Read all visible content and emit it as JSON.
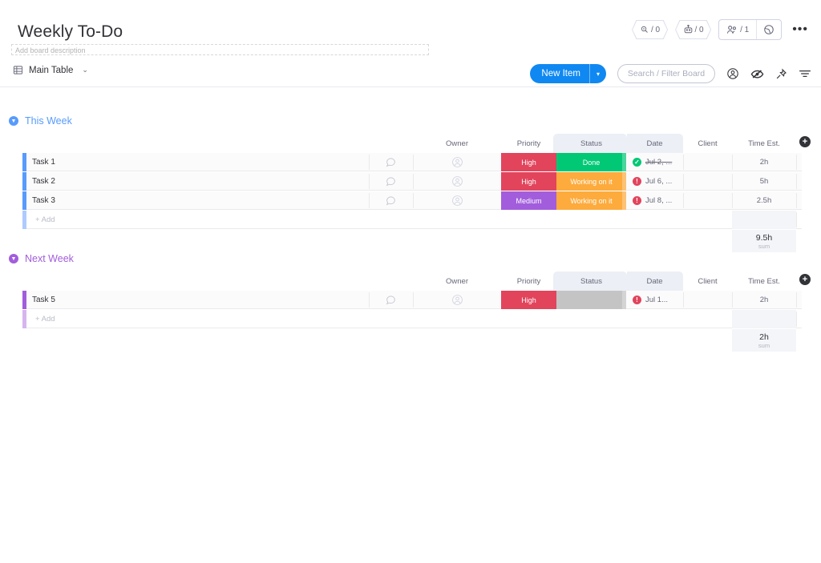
{
  "header": {
    "title": "Weekly To-Do",
    "description_placeholder": "Add board description",
    "automations_count": "/ 0",
    "integrations_count": "/ 0",
    "seats_count": "/ 1",
    "more_label": "•••"
  },
  "view": {
    "tab_label": "Main Table",
    "chevron": "⌄"
  },
  "toolbar": {
    "new_item_label": "New Item",
    "new_item_caret": "▾",
    "search_placeholder": "Search / Filter Board"
  },
  "columns": [
    {
      "key": "owner",
      "label": "Owner"
    },
    {
      "key": "priority",
      "label": "Priority"
    },
    {
      "key": "status",
      "label": "Status"
    },
    {
      "key": "date",
      "label": "Date"
    },
    {
      "key": "client",
      "label": "Client"
    },
    {
      "key": "time",
      "label": "Time Est."
    }
  ],
  "add_column_label": "+",
  "colors": {
    "blue": "#0f88f2",
    "group_blue": "#579bfc",
    "group_purple": "#a25ddc",
    "row_bar_blue": "#579bfc",
    "row_bar_blue_light": "#aecbfd",
    "row_bar_purple": "#a25ddc",
    "row_bar_purple_light": "#d6b5ef",
    "high": "#e2445c",
    "medium": "#a25ddc",
    "done": "#00c875",
    "working": "#fdab3d",
    "empty": "#c4c4c4",
    "badge_done": "#00c875",
    "badge_late": "#e2445c"
  },
  "groups": [
    {
      "name": "This Week",
      "color": "#579bfc",
      "bar_color": "#579bfc",
      "bar_color_light": "#aecbfd",
      "caret": "▾",
      "items": [
        {
          "name": "Task 1",
          "owner": "",
          "priority": {
            "label": "High",
            "color": "#e2445c"
          },
          "status": {
            "label": "Done",
            "color": "#00c875"
          },
          "date": {
            "label": "Jul 2, ...",
            "badge": "✓",
            "badge_color": "#00c875",
            "strikethrough": true
          },
          "client": "",
          "time": "2h"
        },
        {
          "name": "Task 2",
          "owner": "",
          "priority": {
            "label": "High",
            "color": "#e2445c"
          },
          "status": {
            "label": "Working on it",
            "color": "#fdab3d"
          },
          "date": {
            "label": "Jul 6, ...",
            "badge": "!",
            "badge_color": "#e2445c",
            "strikethrough": false
          },
          "client": "",
          "time": "5h"
        },
        {
          "name": "Task 3",
          "owner": "",
          "priority": {
            "label": "Medium",
            "color": "#a25ddc"
          },
          "status": {
            "label": "Working on it",
            "color": "#fdab3d"
          },
          "date": {
            "label": "Jul 8, ...",
            "badge": "!",
            "badge_color": "#e2445c",
            "strikethrough": false
          },
          "client": "",
          "time": "2.5h"
        }
      ],
      "add_label": "+ Add",
      "sum": {
        "value": "9.5h",
        "label": "sum"
      }
    },
    {
      "name": "Next Week",
      "color": "#a25ddc",
      "bar_color": "#a25ddc",
      "bar_color_light": "#d6b5ef",
      "caret": "▾",
      "items": [
        {
          "name": "Task 5",
          "owner": "",
          "priority": {
            "label": "High",
            "color": "#e2445c"
          },
          "status": {
            "label": "",
            "color": "#c4c4c4"
          },
          "date": {
            "label": "Jul 1...",
            "badge": "!",
            "badge_color": "#e2445c",
            "strikethrough": false
          },
          "client": "",
          "time": "2h"
        }
      ],
      "add_label": "+ Add",
      "sum": {
        "value": "2h",
        "label": "sum"
      }
    }
  ]
}
